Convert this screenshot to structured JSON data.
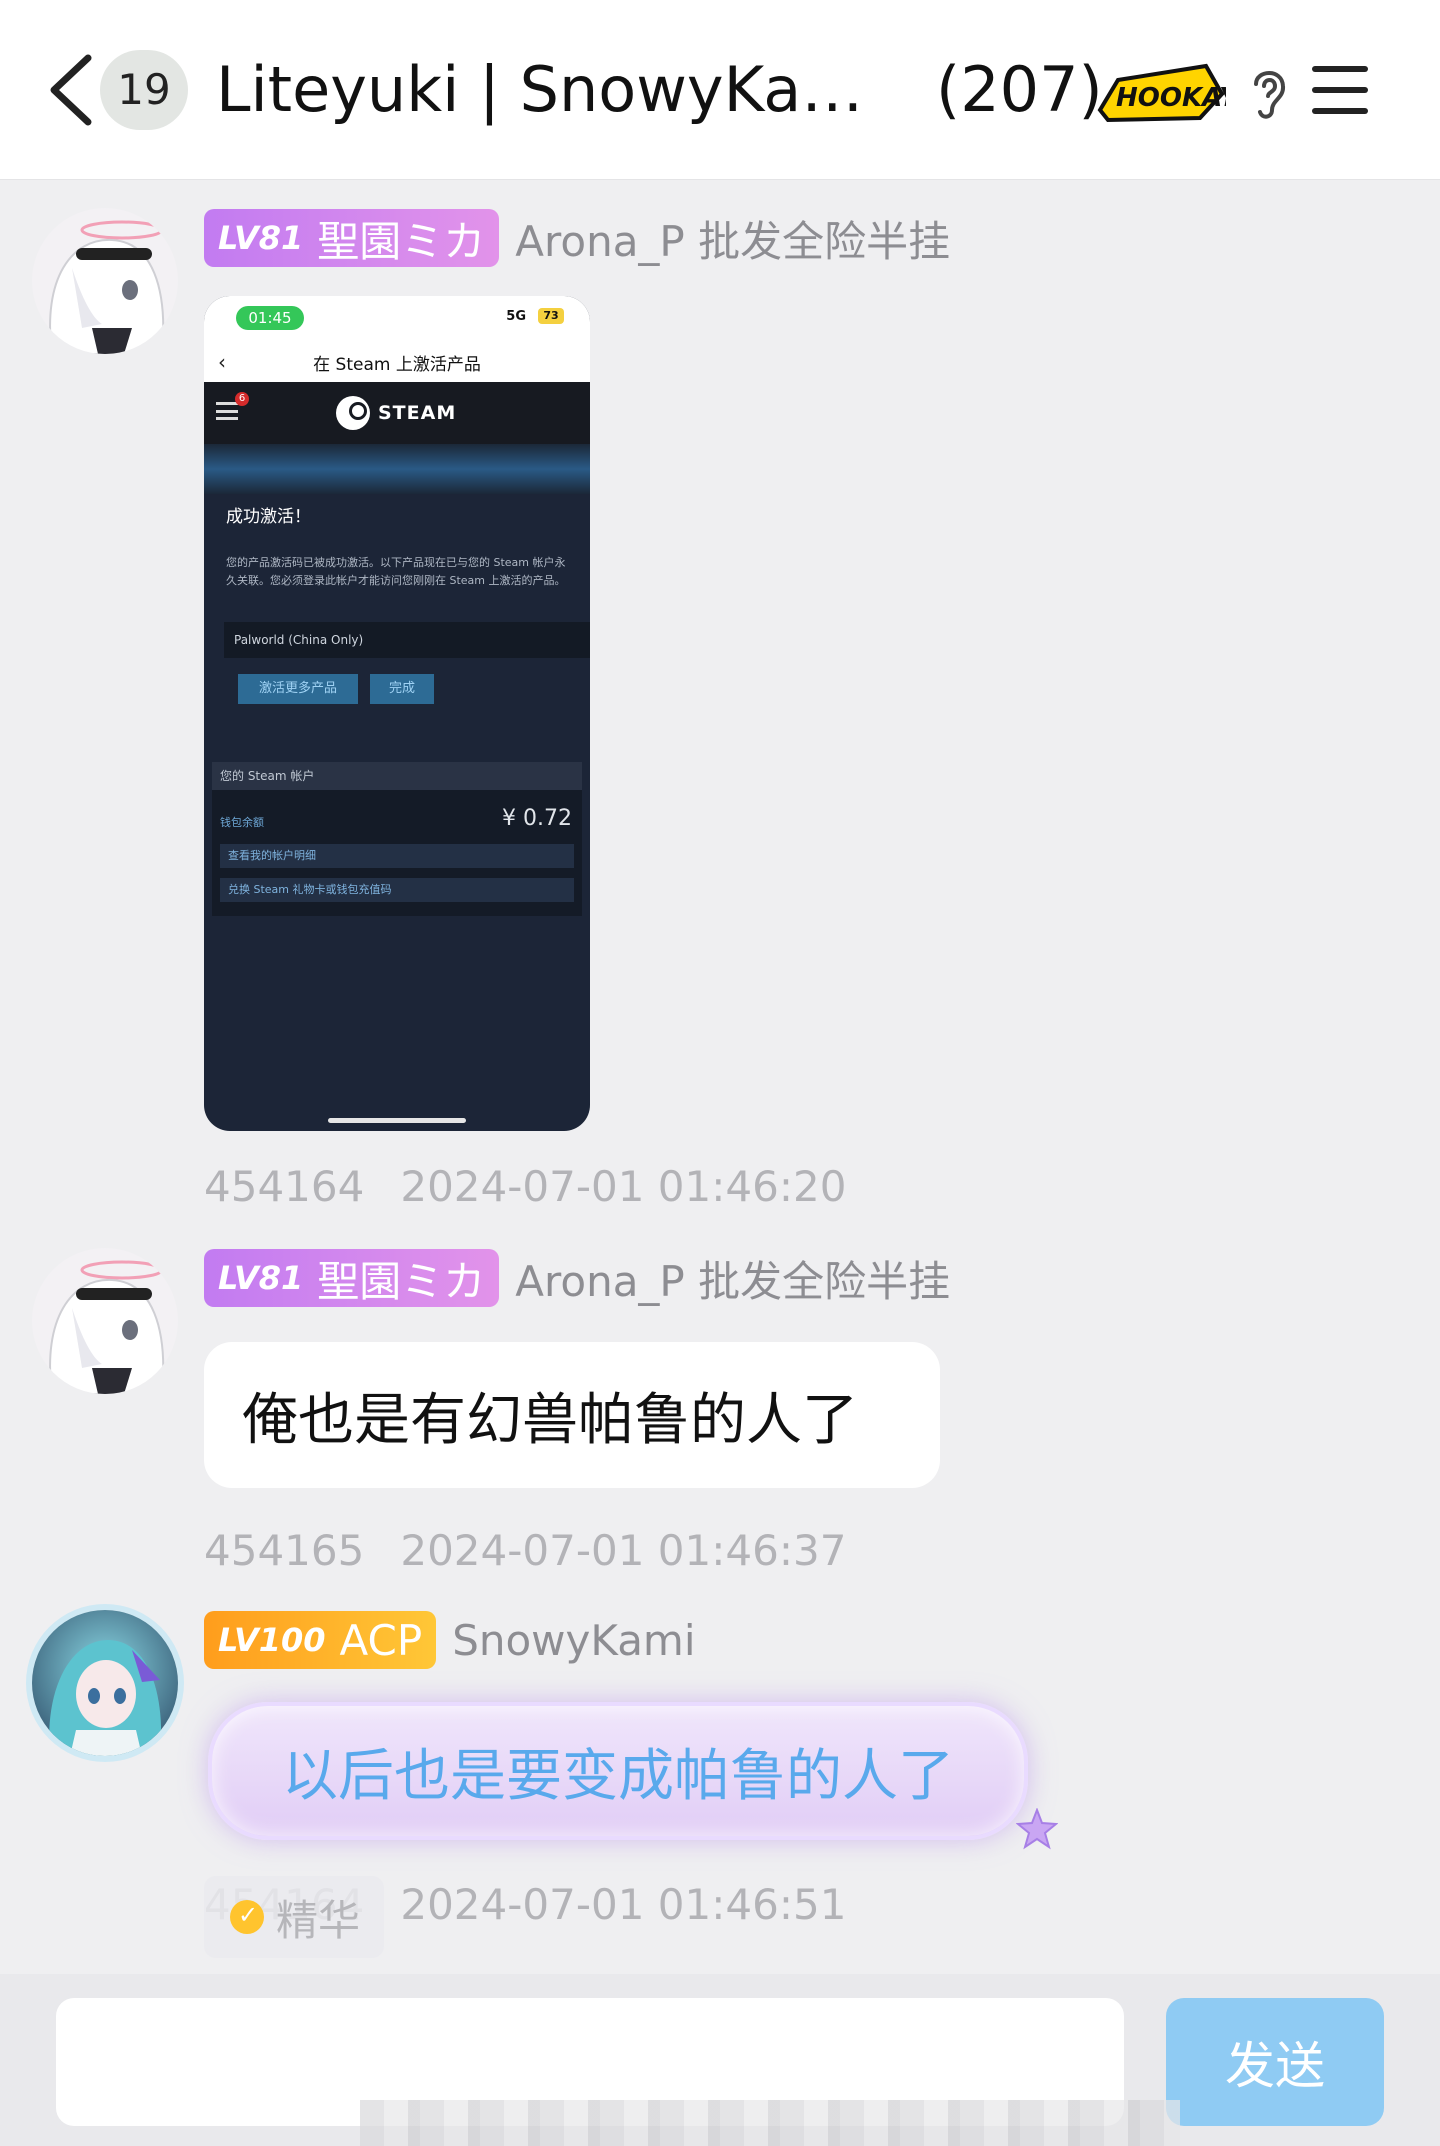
{
  "header": {
    "unread_count": "19",
    "title": "Liteyuki | SnowyKami |...",
    "member_count": "(207)",
    "logo_text": "HOOKAY"
  },
  "messages": [
    {
      "sender_level": "LV81",
      "sender_title": "聖園ミカ",
      "sender_name": "Arona_P 批发全险半挂",
      "msg_id": "454164",
      "time": "2024-07-01 01:46:20",
      "image": {
        "status_time": "01:45",
        "network": "5G",
        "battery": "73",
        "nav_title": "在 Steam 上激活产品",
        "notif_count": "6",
        "steam_word": "STEAM",
        "success_title": "成功激活！",
        "success_body": "您的产品激活码已被成功激活。以下产品现在已与您的 Steam 帐户永久关联。您必须登录此帐户才能访问您刚刚在 Steam 上激活的产品。",
        "product": "Palworld (China Only)",
        "btn_more": "激活更多产品",
        "btn_done": "完成",
        "account_header": "您的 Steam 帐户",
        "wallet_label": "钱包余额",
        "wallet_amount": "¥ 0.72",
        "link_details": "查看我的帐户明细",
        "link_redeem": "兑换 Steam 礼物卡或钱包充值码"
      }
    },
    {
      "sender_level": "LV81",
      "sender_title": "聖園ミカ",
      "sender_name": "Arona_P 批发全险半挂",
      "text": "俺也是有幻兽帕鲁的人了",
      "msg_id": "454165",
      "time": "2024-07-01 01:46:37"
    },
    {
      "sender_level": "LV100",
      "sender_title": "ACP",
      "sender_name": "SnowyKami",
      "text": "以后也是要变成帕鲁的人了",
      "msg_id": "454164",
      "time": "2024-07-01 01:46:51",
      "tag": "精华"
    }
  ],
  "input": {
    "value": "",
    "send_label": "发送"
  },
  "colors": {
    "badge_purple": "#c27bf1",
    "badge_orange": "#ff9d1c",
    "send_button": "#8fcbf3",
    "fancy_text": "#59a9ec"
  }
}
